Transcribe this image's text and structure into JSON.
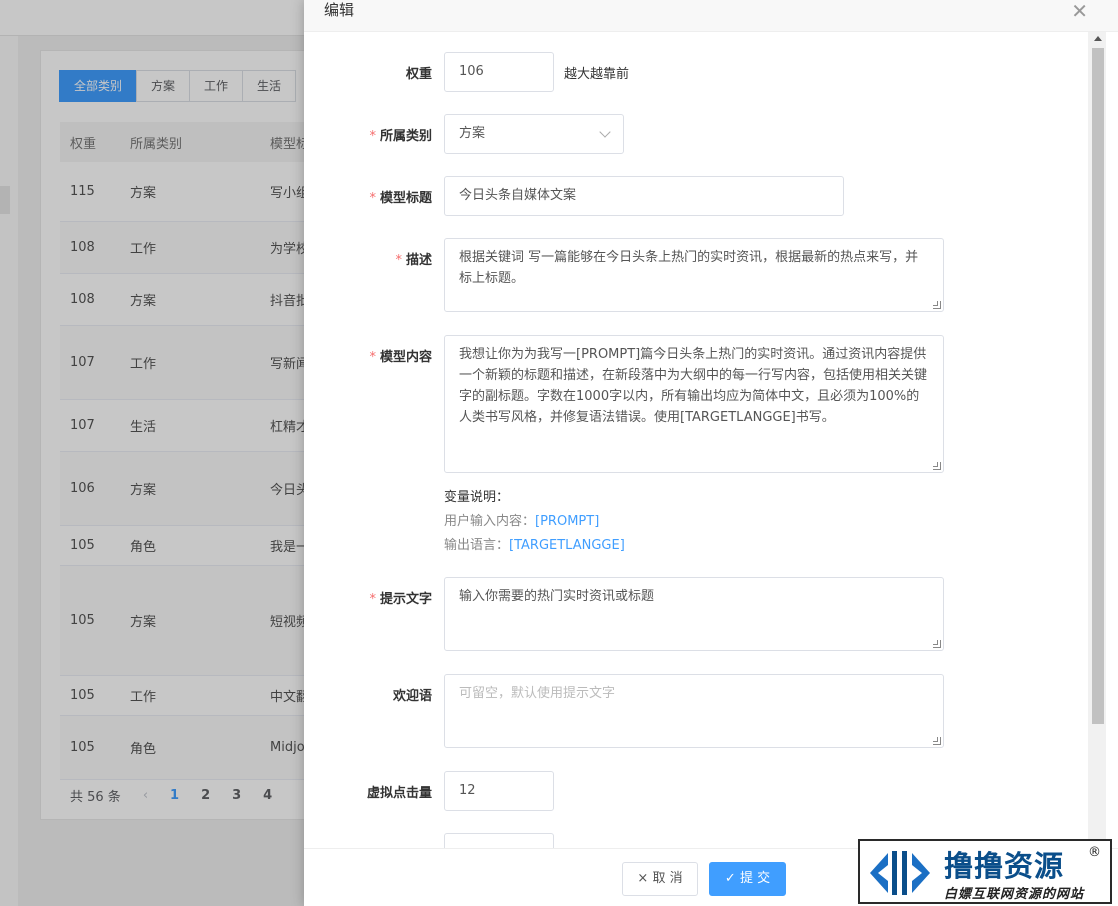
{
  "background": {
    "tabs": [
      "全部类别",
      "方案",
      "工作",
      "生活"
    ],
    "columns": [
      "权重",
      "所属类别",
      "模型标"
    ],
    "rows": [
      {
        "weight": "115",
        "category": "方案",
        "title": "写小组"
      },
      {
        "weight": "108",
        "category": "工作",
        "title": "为学校"
      },
      {
        "weight": "108",
        "category": "方案",
        "title": "抖音批"
      },
      {
        "weight": "107",
        "category": "工作",
        "title": "写新闻"
      },
      {
        "weight": "107",
        "category": "生活",
        "title": "杠精才"
      },
      {
        "weight": "106",
        "category": "方案",
        "title": "今日头"
      },
      {
        "weight": "105",
        "category": "角色",
        "title": "我是一"
      },
      {
        "weight": "105",
        "category": "方案",
        "title": "短视频"
      },
      {
        "weight": "105",
        "category": "工作",
        "title": "中文翻"
      },
      {
        "weight": "105",
        "category": "角色",
        "title": "Midjo"
      }
    ],
    "pager": {
      "total": "共 56 条",
      "prev": "‹",
      "pages": [
        "1",
        "2",
        "3",
        "4"
      ]
    }
  },
  "dialog": {
    "title": "编辑",
    "close_icon": "close-icon",
    "weight": {
      "label": "权重",
      "value": "106",
      "hint": "越大越靠前"
    },
    "category": {
      "label": "所属类别",
      "value": "方案"
    },
    "model_title": {
      "label": "模型标题",
      "value": "今日头条自媒体文案"
    },
    "description": {
      "label": "描述",
      "value": "根据关键词 写一篇能够在今日头条上热门的实时资讯，根据最新的热点来写，并标上标题。"
    },
    "model_content": {
      "label": "模型内容",
      "value": "我想让你为为我写一[PROMPT]篇今日头条上热门的实时资讯。通过资讯内容提供一个新颖的标题和描述，在新段落中为大纲中的每一行写内容，包括使用相关关键字的副标题。字数在1000字以内，所有输出均应为简体中文，且必须为100%的人类书写风格，并修复语法错误。使用[TARGETLANGGE]书写。"
    },
    "variables": {
      "title": "变量说明：",
      "user_input_label": "用户输入内容：",
      "user_input_var": "[PROMPT]",
      "output_lang_label": "输出语言：",
      "output_lang_var": "[TARGETLANGGE]"
    },
    "prompt_text": {
      "label": "提示文字",
      "value": "输入你需要的热门实时资讯或标题"
    },
    "welcome": {
      "label": "欢迎语",
      "placeholder": "可留空，默认使用提示文字"
    },
    "virtual_clicks": {
      "label": "虚拟点击量",
      "value": "12"
    },
    "cancel_label": "取 消",
    "submit_label": "提 交",
    "cancel_icon": "×",
    "submit_icon": "✓"
  },
  "watermark": {
    "title": "撸撸资源",
    "subtitle": "白嫖互联网资源的网站",
    "registered": "®",
    "brand_color": "#0a4e8a"
  },
  "colors": {
    "primary": "#409eff",
    "required": "#f56c6c"
  }
}
